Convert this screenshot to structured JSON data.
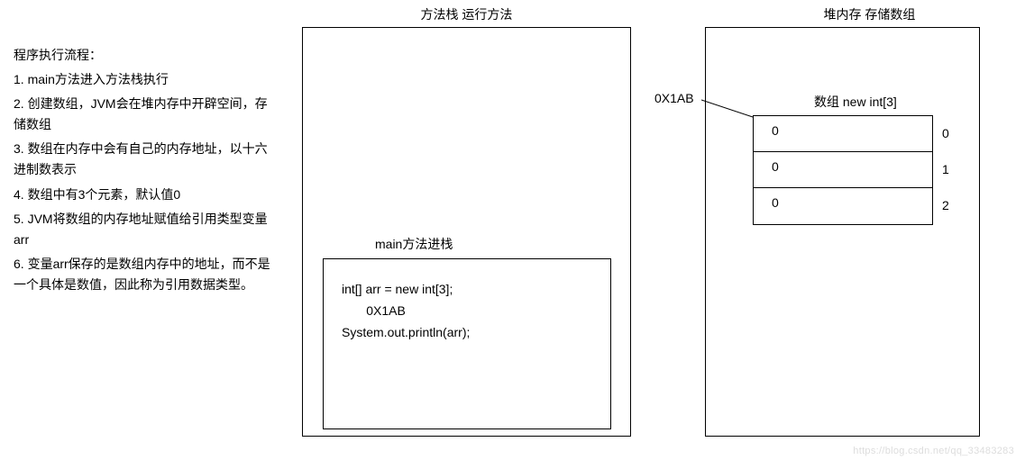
{
  "left": {
    "title": "程序执行流程：",
    "steps": [
      "1. main方法进入方法栈执行",
      "2. 创建数组，JVM会在堆内存中开辟空间，存储数组",
      "3. 数组在内存中会有自己的内存地址，以十六进制数表示",
      "4. 数组中有3个元素，默认值0",
      "5. JVM将数组的内存地址赋值给引用类型变量arr",
      "6. 变量arr保存的是数组内存中的地址，而不是一个具体是数值，因此称为引用数据类型。"
    ]
  },
  "stack": {
    "header": "方法栈    运行方法",
    "mainLabel": "main方法进栈",
    "code": [
      "int[] arr = new int[3];",
      "       0X1AB",
      "System.out.println(arr);"
    ]
  },
  "heap": {
    "header": "堆内存    存储数组",
    "address": "0X1AB",
    "arrayTitle": "数组 new int[3]",
    "cells": [
      "0",
      "0",
      "0"
    ],
    "indices": [
      "0",
      "1",
      "2"
    ]
  },
  "watermark": "https://blog.csdn.net/qq_33483283"
}
